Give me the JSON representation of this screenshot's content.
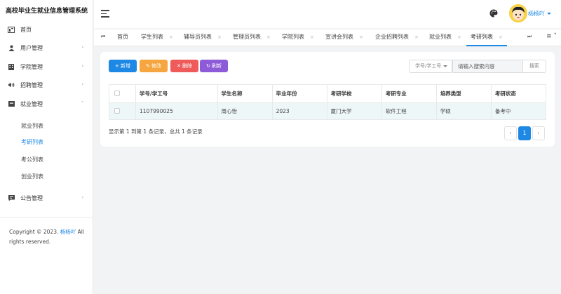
{
  "app": {
    "title": "高校毕业生就业信息管理系统"
  },
  "sidebar": {
    "items": [
      {
        "label": "首页",
        "icon": "dashboard-icon"
      },
      {
        "label": "用户管理",
        "icon": "user-icon"
      },
      {
        "label": "学院管理",
        "icon": "building-icon"
      },
      {
        "label": "招聘管理",
        "icon": "megaphone-icon"
      },
      {
        "label": "就业管理",
        "icon": "archive-icon"
      },
      {
        "label": "公告管理",
        "icon": "message-icon"
      }
    ],
    "sub_items": [
      "就业列表",
      "考研列表",
      "考公列表",
      "创业列表"
    ],
    "active_sub": "考研列表"
  },
  "copyright": {
    "prefix": "Copyright © 2023.",
    "author": "杨杨吖",
    "suffix": "All rights reserved."
  },
  "header": {
    "username": "杨杨吖"
  },
  "tabs": [
    "首页",
    "学生列表",
    "辅导员列表",
    "管理员列表",
    "学院列表",
    "宣讲会列表",
    "企业招聘列表",
    "就业列表",
    "考研列表"
  ],
  "active_tab": "考研列表",
  "toolbar": {
    "add": "+ 新增",
    "edit": "✎ 修改",
    "delete": "✕ 删除",
    "refresh": "↻ 刷新"
  },
  "search": {
    "select_label": "学号/学工号",
    "placeholder": "请输入搜索内容",
    "button": "搜索"
  },
  "table": {
    "headers": [
      "学号/学工号",
      "学生名称",
      "毕业年份",
      "考研学校",
      "考研专业",
      "培养类型",
      "考研状态"
    ],
    "rows": [
      [
        "1107990025",
        "周心怡",
        "2023",
        "厦门大学",
        "软件工程",
        "学硕",
        "备考中"
      ]
    ]
  },
  "pagination": {
    "summary": "显示第 1 到第 1 条记录，总共 1 条记录",
    "prev": "‹",
    "page": "1",
    "next": "›"
  },
  "colors": {
    "primary": "#1e88e5",
    "warning": "#f5a640",
    "danger": "#ef5a5a",
    "purple": "#8e5bd8"
  }
}
